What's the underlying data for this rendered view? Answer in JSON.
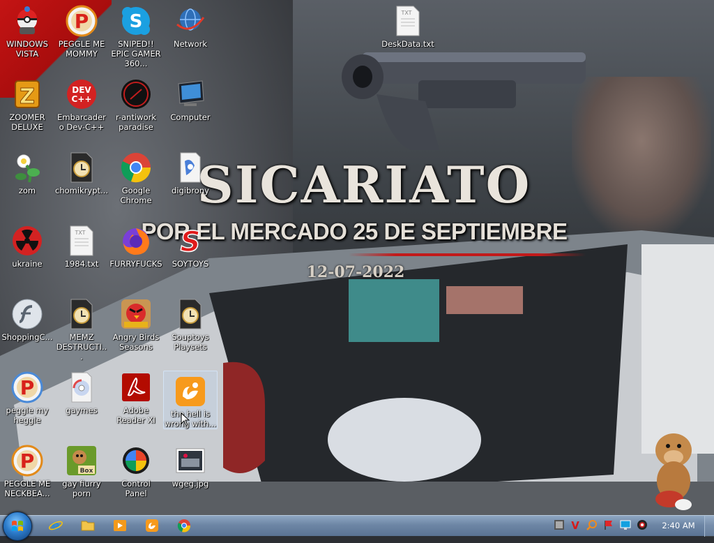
{
  "wallpaper": {
    "title": "SICARIATO",
    "subtitle": "POR EL MERCADO 25 DE SEPTIEMBRE",
    "date": "12-07-2022"
  },
  "desktop": {
    "icons": [
      {
        "label": "WINDOWS VISTA",
        "icon": "pokeball-robot-icon"
      },
      {
        "label": "PEGGLE ME MOMMY",
        "icon": "peggle-icon"
      },
      {
        "label": "SNIPED!! EPIC GAMER 360...",
        "icon": "skype-icon"
      },
      {
        "label": "Network",
        "icon": "network-globe-icon"
      },
      {
        "label": "DeskData.txt",
        "icon": "text-file-icon"
      },
      {
        "label": "ZOOMER DELUXE",
        "icon": "zuma-icon"
      },
      {
        "label": "Embarcadero Dev-C++",
        "icon": "devcpp-icon"
      },
      {
        "label": "r-antiwork paradise",
        "icon": "antiwork-icon"
      },
      {
        "label": "Computer",
        "icon": "computer-icon"
      },
      {
        "label": "zom",
        "icon": "zombie-plant-icon"
      },
      {
        "label": "chomikrypt...",
        "icon": "clock-file-icon"
      },
      {
        "label": "Google Chrome",
        "icon": "chrome-icon"
      },
      {
        "label": "digibrony",
        "icon": "digibrony-icon"
      },
      {
        "label": "ukraine",
        "icon": "radiation-icon"
      },
      {
        "label": "1984.txt",
        "icon": "text-file-icon"
      },
      {
        "label": "FURRYFUCKS",
        "icon": "firefox-icon"
      },
      {
        "label": "SOYTOYS",
        "icon": "soytoys-icon"
      },
      {
        "label": "ShoppingC...",
        "icon": "flash-icon"
      },
      {
        "label": "MEMZ DESTRUCTI...",
        "icon": "clock-file-icon"
      },
      {
        "label": "Angry Birds Seasons",
        "icon": "angry-birds-icon"
      },
      {
        "label": "Souptoys Playsets",
        "icon": "clock-file-icon"
      },
      {
        "label": "peggle my heggle",
        "icon": "peggle-icon"
      },
      {
        "label": "gaymes",
        "icon": "gaymes-icon"
      },
      {
        "label": "Adobe Reader XI",
        "icon": "adobe-reader-icon"
      },
      {
        "label": "the hell is wrong with...",
        "icon": "uc-browser-icon"
      },
      {
        "label": "PEGGLE ME NECKBEA...",
        "icon": "peggle-icon"
      },
      {
        "label": "gay fiurry porn",
        "icon": "box-hamster-icon"
      },
      {
        "label": "Control Panel",
        "icon": "control-panel-icon"
      },
      {
        "label": "wgeg.jpg",
        "icon": "image-file-icon"
      }
    ]
  },
  "taskbar": {
    "pinned": [
      {
        "icon": "internet-explorer-icon"
      },
      {
        "icon": "folder-icon"
      },
      {
        "icon": "media-player-icon"
      },
      {
        "icon": "uc-browser-icon"
      },
      {
        "icon": "chrome-icon"
      }
    ],
    "tray": [
      {
        "icon": "tray-app-icon"
      },
      {
        "icon": "tray-v-icon"
      },
      {
        "icon": "tray-search-icon"
      },
      {
        "icon": "tray-flag-icon"
      },
      {
        "icon": "tray-monitor-icon"
      },
      {
        "icon": "tray-volume-icon"
      }
    ],
    "clock": "2:40 AM"
  },
  "colors": {
    "taskbar": "#6d86a5",
    "accent_red": "#c41414",
    "label_text": "#ffffff"
  }
}
